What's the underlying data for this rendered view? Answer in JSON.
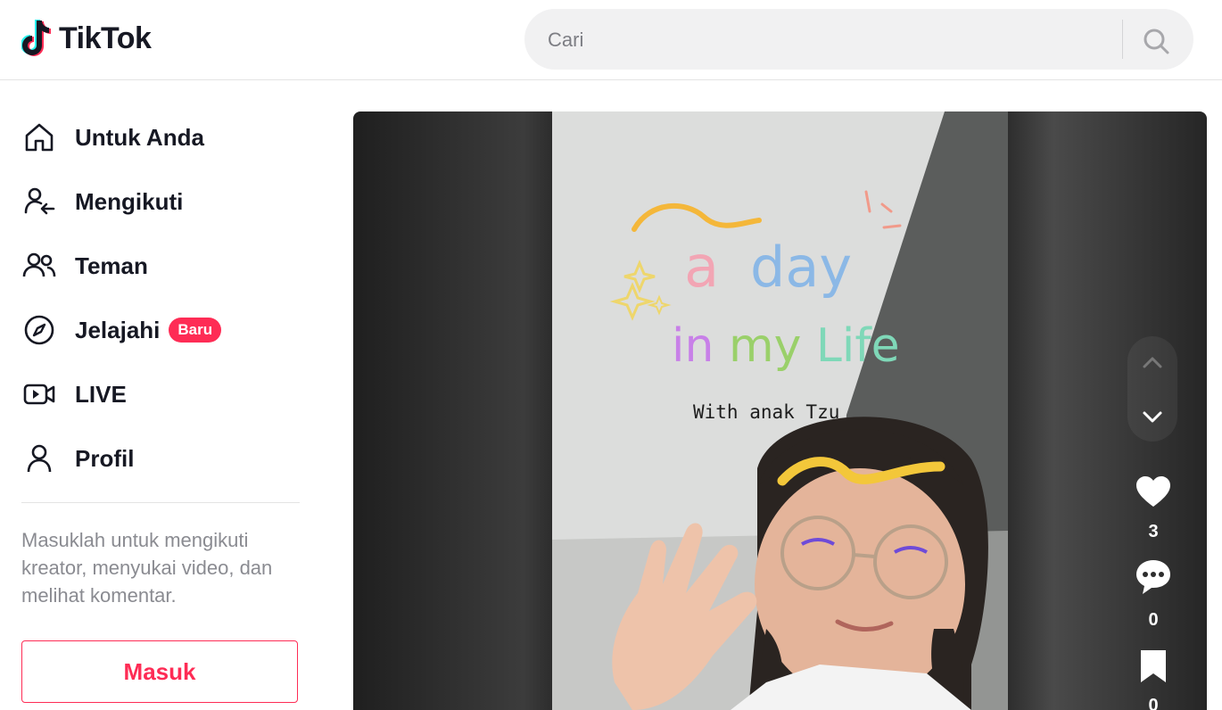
{
  "header": {
    "logo_text": "TikTok",
    "search_placeholder": "Cari"
  },
  "sidebar": {
    "items": [
      {
        "label": "Untuk Anda",
        "icon": "home-icon"
      },
      {
        "label": "Mengikuti",
        "icon": "following-icon"
      },
      {
        "label": "Teman",
        "icon": "friends-icon"
      },
      {
        "label": "Jelajahi",
        "icon": "compass-icon",
        "badge": "Baru"
      },
      {
        "label": "LIVE",
        "icon": "live-icon"
      },
      {
        "label": "Profil",
        "icon": "profile-icon"
      }
    ],
    "login_prompt": "Masuklah untuk mengikuti kreator, menyukai video, dan melihat komentar.",
    "login_button": "Masuk"
  },
  "video": {
    "overlay_title_1": "a day",
    "overlay_title_2": "in my Life",
    "overlay_subtitle": "With anak Tzu",
    "likes": "3",
    "comments": "0",
    "bookmarks": "0"
  },
  "colors": {
    "accent": "#fe2c55",
    "text": "#161823",
    "muted": "#8a8b91"
  }
}
